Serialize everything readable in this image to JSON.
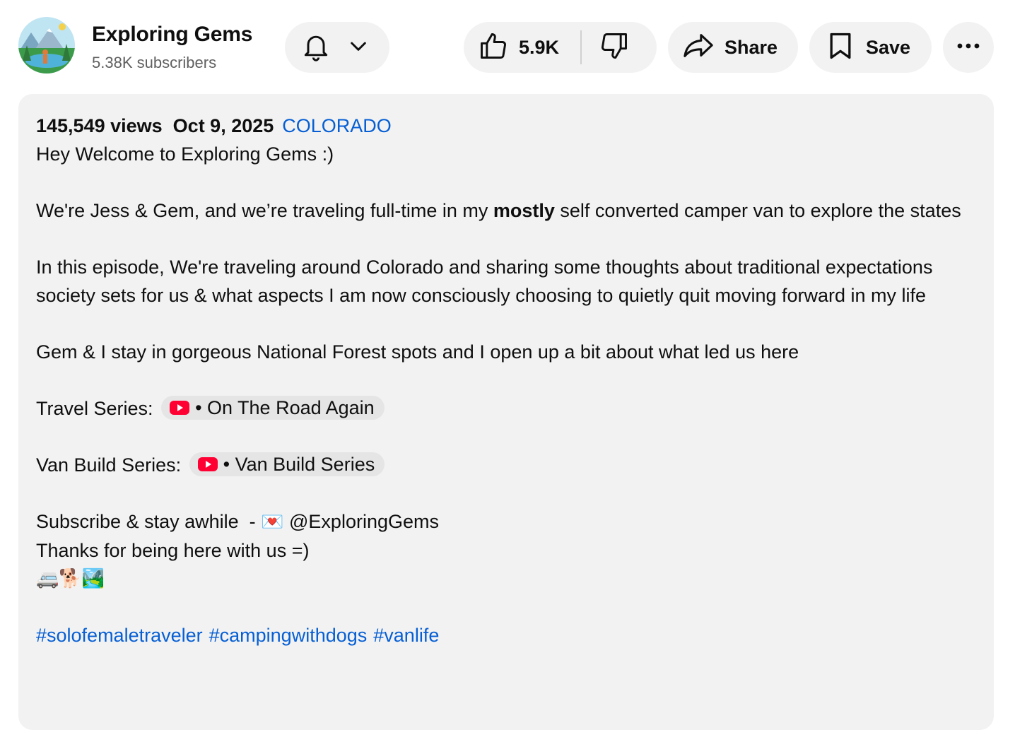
{
  "channel": {
    "name": "Exploring Gems",
    "subscribers": "5.38K subscribers"
  },
  "actions": {
    "likes": "5.9K",
    "share_label": "Share",
    "save_label": "Save"
  },
  "description": {
    "views": "145,549 views",
    "date": "Oct 9, 2025",
    "location": "COLORADO",
    "welcome": "Hey Welcome to Exploring Gems :)",
    "intro_before": "We're Jess & Gem, and we’re traveling full-time in my ",
    "intro_bold": "mostly",
    "intro_after": " self converted camper van to explore the states",
    "episode": "In this episode, We're traveling around Colorado and sharing some thoughts about traditional expectations society sets for us & what aspects I am now consciously choosing to quietly quit moving forward in my life",
    "forest": "Gem & I stay in gorgeous National Forest spots and I open up a bit about what led us here",
    "travel_series_label": "Travel Series:",
    "travel_series_link": "• On The Road Again",
    "van_build_label": "Van Build Series:",
    "van_build_link": "• Van Build Series",
    "subscribe_text": "Subscribe & stay awhile  - ",
    "subscribe_emoji": "💌",
    "subscribe_handle": " @ExploringGems",
    "thanks": "Thanks for being here with us =)",
    "emojis": "🚐🐕🏞️",
    "hashtags": [
      "#solofemaletraveler",
      "#campingwithdogs",
      "#vanlife"
    ]
  },
  "colors": {
    "link": "#065fd4",
    "pill_bg": "#f2f2f2",
    "youtube_red": "#ff0033"
  }
}
